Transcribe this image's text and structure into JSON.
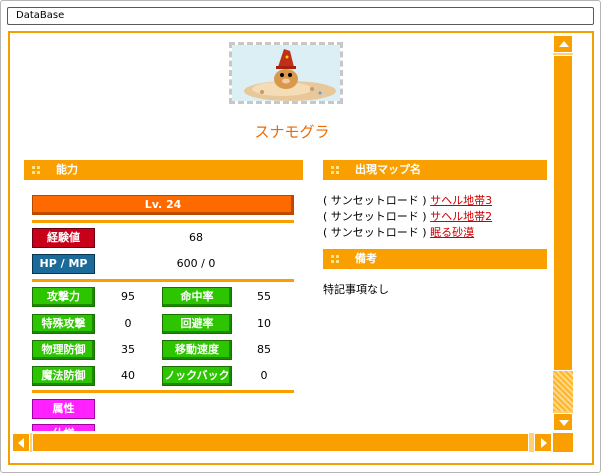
{
  "window": {
    "title": "DataBase"
  },
  "monster": {
    "name": "スナモグラ"
  },
  "sections": {
    "ability": "能力",
    "maps": "出現マップ名",
    "notes": "備考"
  },
  "level": "Lv. 24",
  "exp": {
    "label": "経験値",
    "value": "68"
  },
  "hpmp": {
    "label": "HP / MP",
    "value": "600 / 0"
  },
  "stats": [
    {
      "label": "攻撃力",
      "value": "95"
    },
    {
      "label": "命中率",
      "value": "55"
    },
    {
      "label": "特殊攻撃",
      "value": "0"
    },
    {
      "label": "回避率",
      "value": "10"
    },
    {
      "label": "物理防御",
      "value": "35"
    },
    {
      "label": "移動速度",
      "value": "85"
    },
    {
      "label": "魔法防御",
      "value": "40"
    },
    {
      "label": "ノックバック",
      "value": "0"
    }
  ],
  "attribute": {
    "label": "属性"
  },
  "cut_label": {
    "label": "仕様"
  },
  "maps": [
    {
      "region": "( サンセットロード )",
      "link": "サヘル地帯3"
    },
    {
      "region": "( サンセットロード )",
      "link": "サヘル地帯2"
    },
    {
      "region": "( サンセットロード )",
      "link": "眠る砂漠"
    }
  ],
  "note_text": "特記事項なし",
  "colors": {
    "accent": "#f9a000",
    "name": "#ee6a00",
    "level": "#ff6a00",
    "link": "#cc0000"
  },
  "icons": {
    "scroll_up": "triangle-up",
    "scroll_down": "triangle-down",
    "scroll_left": "triangle-left",
    "scroll_right": "triangle-right"
  }
}
